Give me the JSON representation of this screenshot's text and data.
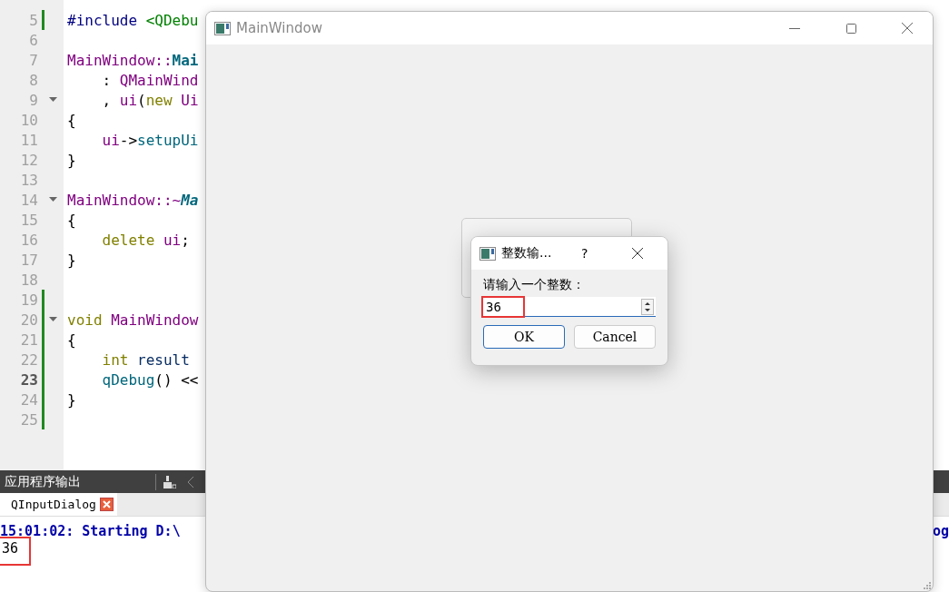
{
  "editor": {
    "lines": [
      {
        "number": "5",
        "foldable": false,
        "changed": true,
        "current": false,
        "tokens": [
          {
            "text": "#include",
            "kind": "pre"
          },
          {
            "text": " <QDebu",
            "kind": "inc"
          }
        ]
      },
      {
        "number": "6",
        "foldable": false,
        "changed": false,
        "current": false
      },
      {
        "number": "7",
        "foldable": false,
        "changed": false,
        "current": false,
        "tokens": [
          {
            "text": "MainWindow::",
            "kind": "type"
          },
          {
            "text": "Mai",
            "kind": "decl"
          }
        ]
      },
      {
        "number": "8",
        "foldable": false,
        "changed": false,
        "current": false,
        "tokens": [
          {
            "text": "    : ",
            "kind": "plain"
          },
          {
            "text": "QMainWind",
            "kind": "type"
          }
        ]
      },
      {
        "number": "9",
        "foldable": true,
        "changed": false,
        "current": false,
        "tokens": [
          {
            "text": "    , ",
            "kind": "plain"
          },
          {
            "text": "ui",
            "kind": "type"
          },
          {
            "text": "(",
            "kind": "plain"
          },
          {
            "text": "new",
            "kind": "kw"
          },
          {
            "text": " Ui",
            "kind": "type"
          }
        ]
      },
      {
        "number": "10",
        "foldable": false,
        "changed": false,
        "current": false,
        "tokens": [
          {
            "text": "{",
            "kind": "plain"
          }
        ]
      },
      {
        "number": "11",
        "foldable": false,
        "changed": false,
        "current": false,
        "tokens": [
          {
            "text": "    ui",
            "kind": "type"
          },
          {
            "text": "->",
            "kind": "plain"
          },
          {
            "text": "setupUi",
            "kind": "func"
          }
        ]
      },
      {
        "number": "12",
        "foldable": false,
        "changed": false,
        "current": false,
        "tokens": [
          {
            "text": "}",
            "kind": "plain"
          }
        ]
      },
      {
        "number": "13",
        "foldable": false,
        "changed": false,
        "current": false
      },
      {
        "number": "14",
        "foldable": true,
        "changed": false,
        "current": false,
        "tokens": [
          {
            "text": "MainWindow::~",
            "kind": "type"
          },
          {
            "text": "Ma",
            "kind": "decl-italic"
          }
        ]
      },
      {
        "number": "15",
        "foldable": false,
        "changed": false,
        "current": false,
        "tokens": [
          {
            "text": "{",
            "kind": "plain"
          }
        ]
      },
      {
        "number": "16",
        "foldable": false,
        "changed": false,
        "current": false,
        "tokens": [
          {
            "text": "    delete",
            "kind": "kw"
          },
          {
            "text": " ui",
            "kind": "type"
          },
          {
            "text": ";",
            "kind": "plain"
          }
        ]
      },
      {
        "number": "17",
        "foldable": false,
        "changed": false,
        "current": false,
        "tokens": [
          {
            "text": "}",
            "kind": "plain"
          }
        ]
      },
      {
        "number": "18",
        "foldable": false,
        "changed": false,
        "current": false
      },
      {
        "number": "19",
        "foldable": false,
        "changed": true,
        "current": false
      },
      {
        "number": "20",
        "foldable": true,
        "changed": true,
        "current": false,
        "tokens": [
          {
            "text": "void",
            "kind": "kw"
          },
          {
            "text": " MainWindow",
            "kind": "type"
          }
        ]
      },
      {
        "number": "21",
        "foldable": false,
        "changed": true,
        "current": false,
        "tokens": [
          {
            "text": "{",
            "kind": "plain"
          }
        ]
      },
      {
        "number": "22",
        "foldable": false,
        "changed": true,
        "current": false,
        "tokens": [
          {
            "text": "    int",
            "kind": "kw"
          },
          {
            "text": " result",
            "kind": "var"
          }
        ]
      },
      {
        "number": "23",
        "foldable": false,
        "changed": true,
        "current": true,
        "tokens": [
          {
            "text": "    qDebug",
            "kind": "func"
          },
          {
            "text": "() <<",
            "kind": "plain"
          }
        ]
      },
      {
        "number": "24",
        "foldable": false,
        "changed": true,
        "current": false,
        "tokens": [
          {
            "text": "}",
            "kind": "plain"
          }
        ]
      },
      {
        "number": "25",
        "foldable": false,
        "changed": true,
        "current": false
      }
    ]
  },
  "output_panel": {
    "title": "应用程序输出",
    "tabs": [
      {
        "label": "QInputDialog",
        "selected": true
      }
    ],
    "lines": [
      {
        "text": "15:01:02: Starting D:\\",
        "kind": "status",
        "tail": "og",
        "highlighted": false
      },
      {
        "text": "36",
        "kind": "plain",
        "highlighted": true
      }
    ]
  },
  "main_window": {
    "title": "MainWindow"
  },
  "dialog": {
    "title": "整数输...",
    "help": "?",
    "label": "请输入一个整数：",
    "value": "36",
    "value_highlighted": true,
    "buttons": [
      {
        "label": "OK",
        "default": true
      },
      {
        "label": "Cancel",
        "default": false
      }
    ]
  }
}
